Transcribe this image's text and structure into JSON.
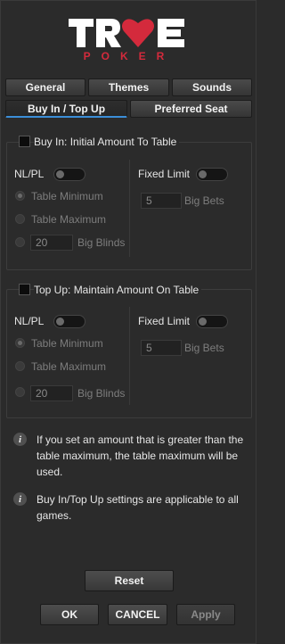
{
  "logo": {
    "brand": "TRUE",
    "sub": "POKER"
  },
  "tabs": {
    "general": "General",
    "themes": "Themes",
    "sounds": "Sounds",
    "buyin_topup": "Buy In / Top Up",
    "preferred_seat": "Preferred Seat"
  },
  "buy_in": {
    "title": "Buy In: Initial Amount To Table",
    "nlpl_label": "NL/PL",
    "fixed_limit_label": "Fixed Limit",
    "table_min_label": "Table Minimum",
    "table_max_label": "Table Maximum",
    "big_blinds_value": "20",
    "big_blinds_label": "Big Blinds",
    "big_bets_value": "5",
    "big_bets_label": "Big Bets"
  },
  "top_up": {
    "title": "Top Up: Maintain Amount On Table",
    "nlpl_label": "NL/PL",
    "fixed_limit_label": "Fixed Limit",
    "table_min_label": "Table Minimum",
    "table_max_label": "Table Maximum",
    "big_blinds_value": "20",
    "big_blinds_label": "Big Blinds",
    "big_bets_value": "5",
    "big_bets_label": "Big Bets"
  },
  "info": {
    "line1": "If you set an amount that is greater than the table maximum, the table maximum will be used.",
    "line2": "Buy In/Top Up settings are applicable to all games."
  },
  "buttons": {
    "reset": "Reset",
    "ok": "OK",
    "cancel": "CANCEL",
    "apply": "Apply"
  },
  "colors": {
    "accent": "#3b8ed8",
    "logo_red": "#d42a3c",
    "background": "#2b2b2b"
  },
  "icons": {
    "info": "info-icon"
  }
}
